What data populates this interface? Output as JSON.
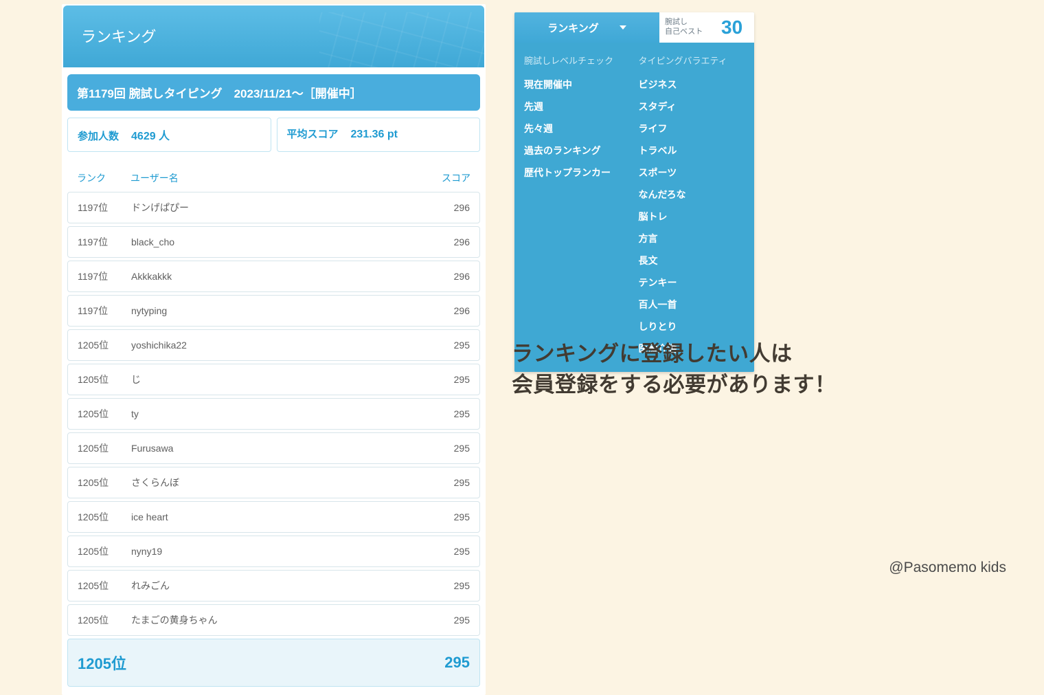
{
  "ranking": {
    "header_title": "ランキング",
    "event_title": "第1179回 腕試しタイピング　2023/11/21～［開催中］",
    "participants_label": "参加人数",
    "participants_value": "4629 人",
    "avg_label": "平均スコア",
    "avg_value": "231.36 pt",
    "cols": {
      "rank": "ランク",
      "user": "ユーザー名",
      "score": "スコア"
    },
    "rows": [
      {
        "rank": "1197位",
        "user": "ドンげぱぴー",
        "score": "296"
      },
      {
        "rank": "1197位",
        "user": "black_cho",
        "score": "296"
      },
      {
        "rank": "1197位",
        "user": "Akkkakkk",
        "score": "296"
      },
      {
        "rank": "1197位",
        "user": "nytyping",
        "score": "296"
      },
      {
        "rank": "1205位",
        "user": "yoshichika22",
        "score": "295"
      },
      {
        "rank": "1205位",
        "user": "じ",
        "score": "295"
      },
      {
        "rank": "1205位",
        "user": "ty",
        "score": "295"
      },
      {
        "rank": "1205位",
        "user": "Furusawa",
        "score": "295"
      },
      {
        "rank": "1205位",
        "user": "さくらんぼ",
        "score": "295"
      },
      {
        "rank": "1205位",
        "user": "ice heart",
        "score": "295"
      },
      {
        "rank": "1205位",
        "user": "nyny19",
        "score": "295"
      },
      {
        "rank": "1205位",
        "user": "れみごん",
        "score": "295"
      },
      {
        "rank": "1205位",
        "user": "たまごの黄身ちゃん",
        "score": "295"
      }
    ],
    "highlight": {
      "rank": "1205位",
      "user": "",
      "score": "295"
    }
  },
  "nav": {
    "active_tab": "ランキング",
    "tab_best_label": "腕試し\n自己ベスト",
    "tab_score": "30",
    "col1_title": "腕試しレベルチェック",
    "col1_items": [
      "現在開催中",
      "先週",
      "先々週",
      "過去のランキング",
      "歴代トップランカー"
    ],
    "col2_title": "タイピングバラエティ",
    "col2_items": [
      "ビジネス",
      "スタディ",
      "ライフ",
      "トラベル",
      "スポーツ",
      "なんだろな",
      "脳トレ",
      "方言",
      "長文",
      "テンキー",
      "百人一首",
      "しりとり",
      "医療介護"
    ]
  },
  "message_line1": "ランキングに登録したい人は",
  "message_line2": "会員登録をする必要があります！",
  "credit": "@Pasomemo kids"
}
